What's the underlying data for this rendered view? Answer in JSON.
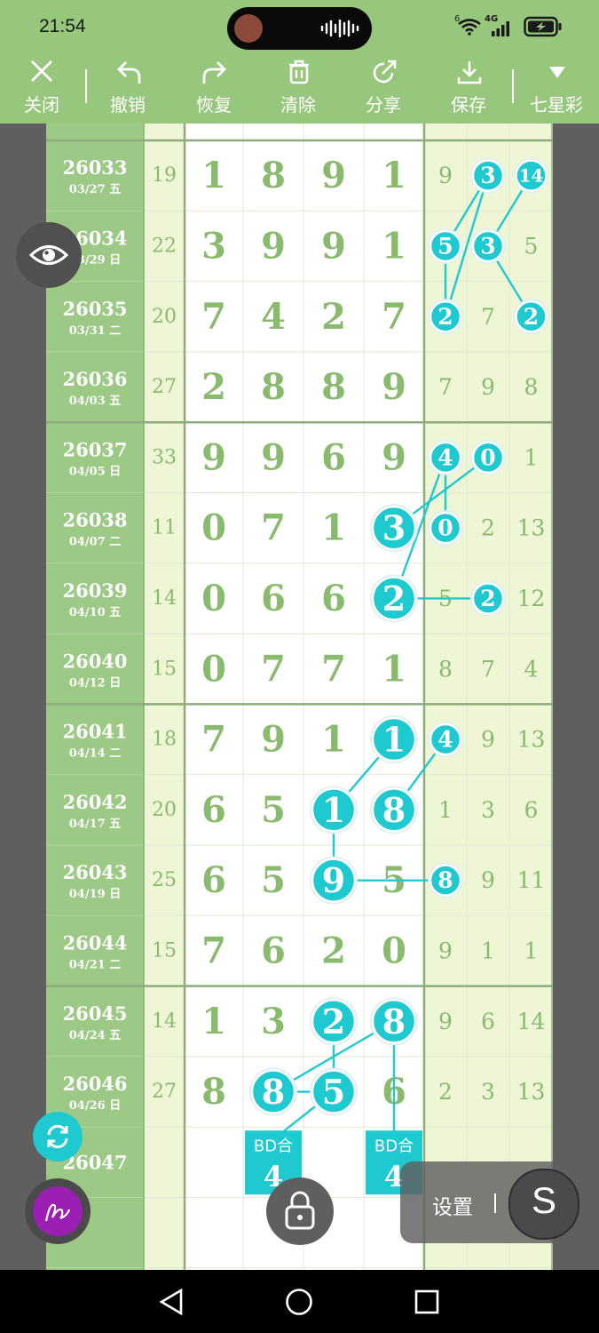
{
  "status": {
    "time": "21:54",
    "network": "4G",
    "sim_badge": "6",
    "battery_charging": true
  },
  "toolbar": {
    "close": "关闭",
    "undo": "撤销",
    "redo": "恢复",
    "clear": "清除",
    "share": "分享",
    "save": "保存",
    "lottery": "七星彩"
  },
  "colors": {
    "accent": "#97c77d",
    "highlight": "#1ec9d0",
    "number_green": "#8aba6e",
    "label_bg": "#9cc985"
  },
  "rows": [
    {
      "issue": "26033",
      "date": "03/27 五",
      "sum": "19",
      "digits": [
        "1",
        "8",
        "9",
        "1"
      ],
      "tail": [
        "9",
        "3",
        "14"
      ]
    },
    {
      "issue": "26034",
      "date": "03/29 日",
      "sum": "22",
      "digits": [
        "3",
        "9",
        "9",
        "1"
      ],
      "tail": [
        "5",
        "3",
        "5"
      ]
    },
    {
      "issue": "26035",
      "date": "03/31 二",
      "sum": "20",
      "digits": [
        "7",
        "4",
        "2",
        "7"
      ],
      "tail": [
        "2",
        "7",
        "2"
      ]
    },
    {
      "issue": "26036",
      "date": "04/03 五",
      "sum": "27",
      "digits": [
        "2",
        "8",
        "8",
        "9"
      ],
      "tail": [
        "7",
        "9",
        "8"
      ]
    },
    {
      "issue": "26037",
      "date": "04/05 日",
      "sum": "33",
      "digits": [
        "9",
        "9",
        "6",
        "9"
      ],
      "tail": [
        "4",
        "0",
        "1"
      ]
    },
    {
      "issue": "26038",
      "date": "04/07 二",
      "sum": "11",
      "digits": [
        "0",
        "7",
        "1",
        "3"
      ],
      "tail": [
        "0",
        "2",
        "13"
      ]
    },
    {
      "issue": "26039",
      "date": "04/10 五",
      "sum": "14",
      "digits": [
        "0",
        "6",
        "6",
        "2"
      ],
      "tail": [
        "5",
        "2",
        "12"
      ]
    },
    {
      "issue": "26040",
      "date": "04/12 日",
      "sum": "15",
      "digits": [
        "0",
        "7",
        "7",
        "1"
      ],
      "tail": [
        "8",
        "7",
        "4"
      ]
    },
    {
      "issue": "26041",
      "date": "04/14 二",
      "sum": "18",
      "digits": [
        "7",
        "9",
        "1",
        "1"
      ],
      "tail": [
        "4",
        "9",
        "13"
      ]
    },
    {
      "issue": "26042",
      "date": "04/17 五",
      "sum": "20",
      "digits": [
        "6",
        "5",
        "1",
        "8"
      ],
      "tail": [
        "1",
        "3",
        "6"
      ]
    },
    {
      "issue": "26043",
      "date": "04/19 日",
      "sum": "25",
      "digits": [
        "6",
        "5",
        "9",
        "5"
      ],
      "tail": [
        "8",
        "9",
        "11"
      ]
    },
    {
      "issue": "26044",
      "date": "04/21 二",
      "sum": "15",
      "digits": [
        "7",
        "6",
        "2",
        "0"
      ],
      "tail": [
        "9",
        "1",
        "1"
      ]
    },
    {
      "issue": "26045",
      "date": "04/24 五",
      "sum": "14",
      "digits": [
        "1",
        "3",
        "2",
        "8"
      ],
      "tail": [
        "9",
        "6",
        "14"
      ]
    },
    {
      "issue": "26046",
      "date": "04/26 日",
      "sum": "27",
      "digits": [
        "8",
        "8",
        "5",
        "6"
      ],
      "tail": [
        "2",
        "3",
        "13"
      ]
    },
    {
      "issue": "26047",
      "date": "",
      "sum": "",
      "digits": [
        "",
        "",
        "",
        ""
      ],
      "tail": [
        "",
        "",
        ""
      ]
    }
  ],
  "circles": [
    {
      "row": 0,
      "col": "tail1",
      "value": "3"
    },
    {
      "row": 0,
      "col": "tail2",
      "value": "14"
    },
    {
      "row": 1,
      "col": "tail0",
      "value": "5"
    },
    {
      "row": 1,
      "col": "tail1",
      "value": "3"
    },
    {
      "row": 2,
      "col": "tail0",
      "value": "2"
    },
    {
      "row": 2,
      "col": "tail2",
      "value": "2"
    },
    {
      "row": 4,
      "col": "tail0",
      "value": "4"
    },
    {
      "row": 4,
      "col": "tail1",
      "value": "0"
    },
    {
      "row": 5,
      "col": "d3",
      "value": "3"
    },
    {
      "row": 5,
      "col": "tail0",
      "value": "0"
    },
    {
      "row": 6,
      "col": "d3",
      "value": "2"
    },
    {
      "row": 6,
      "col": "tail1",
      "value": "2"
    },
    {
      "row": 8,
      "col": "d3",
      "value": "1"
    },
    {
      "row": 8,
      "col": "tail0",
      "value": "4"
    },
    {
      "row": 9,
      "col": "d2",
      "value": "1"
    },
    {
      "row": 9,
      "col": "d3",
      "value": "8"
    },
    {
      "row": 10,
      "col": "d2",
      "value": "9"
    },
    {
      "row": 10,
      "col": "tail0",
      "value": "8"
    },
    {
      "row": 12,
      "col": "d2",
      "value": "2"
    },
    {
      "row": 12,
      "col": "d3",
      "value": "8"
    },
    {
      "row": 13,
      "col": "d1",
      "value": "8"
    },
    {
      "row": 13,
      "col": "d2",
      "value": "5"
    }
  ],
  "predictions": [
    {
      "col": "d1",
      "label": "BD合",
      "value": "4"
    },
    {
      "col": "d3",
      "label": "BD合",
      "value": "4"
    }
  ],
  "floating": {
    "settings": "设置",
    "s_button": "S"
  }
}
